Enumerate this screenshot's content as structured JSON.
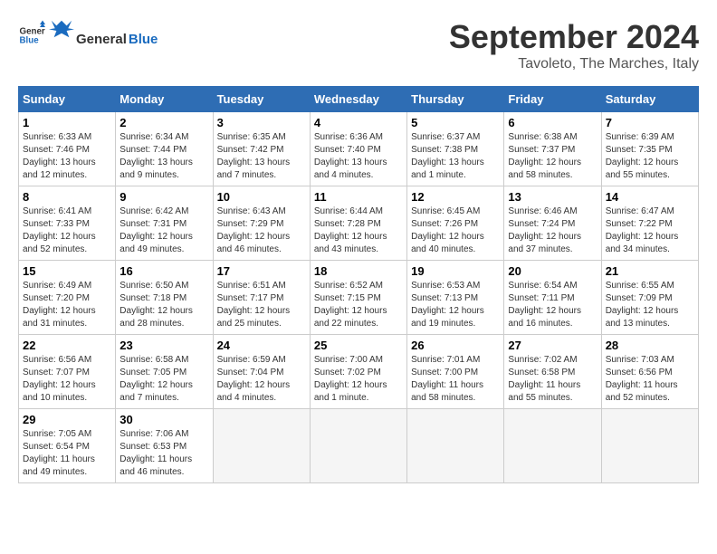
{
  "header": {
    "logo_general": "General",
    "logo_blue": "Blue",
    "month_title": "September 2024",
    "location": "Tavoleto, The Marches, Italy"
  },
  "calendar": {
    "days_of_week": [
      "Sunday",
      "Monday",
      "Tuesday",
      "Wednesday",
      "Thursday",
      "Friday",
      "Saturday"
    ],
    "weeks": [
      [
        {
          "day": "1",
          "sunrise": "6:33 AM",
          "sunset": "7:46 PM",
          "daylight": "13 hours and 12 minutes."
        },
        {
          "day": "2",
          "sunrise": "6:34 AM",
          "sunset": "7:44 PM",
          "daylight": "13 hours and 9 minutes."
        },
        {
          "day": "3",
          "sunrise": "6:35 AM",
          "sunset": "7:42 PM",
          "daylight": "13 hours and 7 minutes."
        },
        {
          "day": "4",
          "sunrise": "6:36 AM",
          "sunset": "7:40 PM",
          "daylight": "13 hours and 4 minutes."
        },
        {
          "day": "5",
          "sunrise": "6:37 AM",
          "sunset": "7:38 PM",
          "daylight": "13 hours and 1 minute."
        },
        {
          "day": "6",
          "sunrise": "6:38 AM",
          "sunset": "7:37 PM",
          "daylight": "12 hours and 58 minutes."
        },
        {
          "day": "7",
          "sunrise": "6:39 AM",
          "sunset": "7:35 PM",
          "daylight": "12 hours and 55 minutes."
        }
      ],
      [
        {
          "day": "8",
          "sunrise": "6:41 AM",
          "sunset": "7:33 PM",
          "daylight": "12 hours and 52 minutes."
        },
        {
          "day": "9",
          "sunrise": "6:42 AM",
          "sunset": "7:31 PM",
          "daylight": "12 hours and 49 minutes."
        },
        {
          "day": "10",
          "sunrise": "6:43 AM",
          "sunset": "7:29 PM",
          "daylight": "12 hours and 46 minutes."
        },
        {
          "day": "11",
          "sunrise": "6:44 AM",
          "sunset": "7:28 PM",
          "daylight": "12 hours and 43 minutes."
        },
        {
          "day": "12",
          "sunrise": "6:45 AM",
          "sunset": "7:26 PM",
          "daylight": "12 hours and 40 minutes."
        },
        {
          "day": "13",
          "sunrise": "6:46 AM",
          "sunset": "7:24 PM",
          "daylight": "12 hours and 37 minutes."
        },
        {
          "day": "14",
          "sunrise": "6:47 AM",
          "sunset": "7:22 PM",
          "daylight": "12 hours and 34 minutes."
        }
      ],
      [
        {
          "day": "15",
          "sunrise": "6:49 AM",
          "sunset": "7:20 PM",
          "daylight": "12 hours and 31 minutes."
        },
        {
          "day": "16",
          "sunrise": "6:50 AM",
          "sunset": "7:18 PM",
          "daylight": "12 hours and 28 minutes."
        },
        {
          "day": "17",
          "sunrise": "6:51 AM",
          "sunset": "7:17 PM",
          "daylight": "12 hours and 25 minutes."
        },
        {
          "day": "18",
          "sunrise": "6:52 AM",
          "sunset": "7:15 PM",
          "daylight": "12 hours and 22 minutes."
        },
        {
          "day": "19",
          "sunrise": "6:53 AM",
          "sunset": "7:13 PM",
          "daylight": "12 hours and 19 minutes."
        },
        {
          "day": "20",
          "sunrise": "6:54 AM",
          "sunset": "7:11 PM",
          "daylight": "12 hours and 16 minutes."
        },
        {
          "day": "21",
          "sunrise": "6:55 AM",
          "sunset": "7:09 PM",
          "daylight": "12 hours and 13 minutes."
        }
      ],
      [
        {
          "day": "22",
          "sunrise": "6:56 AM",
          "sunset": "7:07 PM",
          "daylight": "12 hours and 10 minutes."
        },
        {
          "day": "23",
          "sunrise": "6:58 AM",
          "sunset": "7:05 PM",
          "daylight": "12 hours and 7 minutes."
        },
        {
          "day": "24",
          "sunrise": "6:59 AM",
          "sunset": "7:04 PM",
          "daylight": "12 hours and 4 minutes."
        },
        {
          "day": "25",
          "sunrise": "7:00 AM",
          "sunset": "7:02 PM",
          "daylight": "12 hours and 1 minute."
        },
        {
          "day": "26",
          "sunrise": "7:01 AM",
          "sunset": "7:00 PM",
          "daylight": "11 hours and 58 minutes."
        },
        {
          "day": "27",
          "sunrise": "7:02 AM",
          "sunset": "6:58 PM",
          "daylight": "11 hours and 55 minutes."
        },
        {
          "day": "28",
          "sunrise": "7:03 AM",
          "sunset": "6:56 PM",
          "daylight": "11 hours and 52 minutes."
        }
      ],
      [
        {
          "day": "29",
          "sunrise": "7:05 AM",
          "sunset": "6:54 PM",
          "daylight": "11 hours and 49 minutes."
        },
        {
          "day": "30",
          "sunrise": "7:06 AM",
          "sunset": "6:53 PM",
          "daylight": "11 hours and 46 minutes."
        },
        null,
        null,
        null,
        null,
        null
      ]
    ]
  }
}
